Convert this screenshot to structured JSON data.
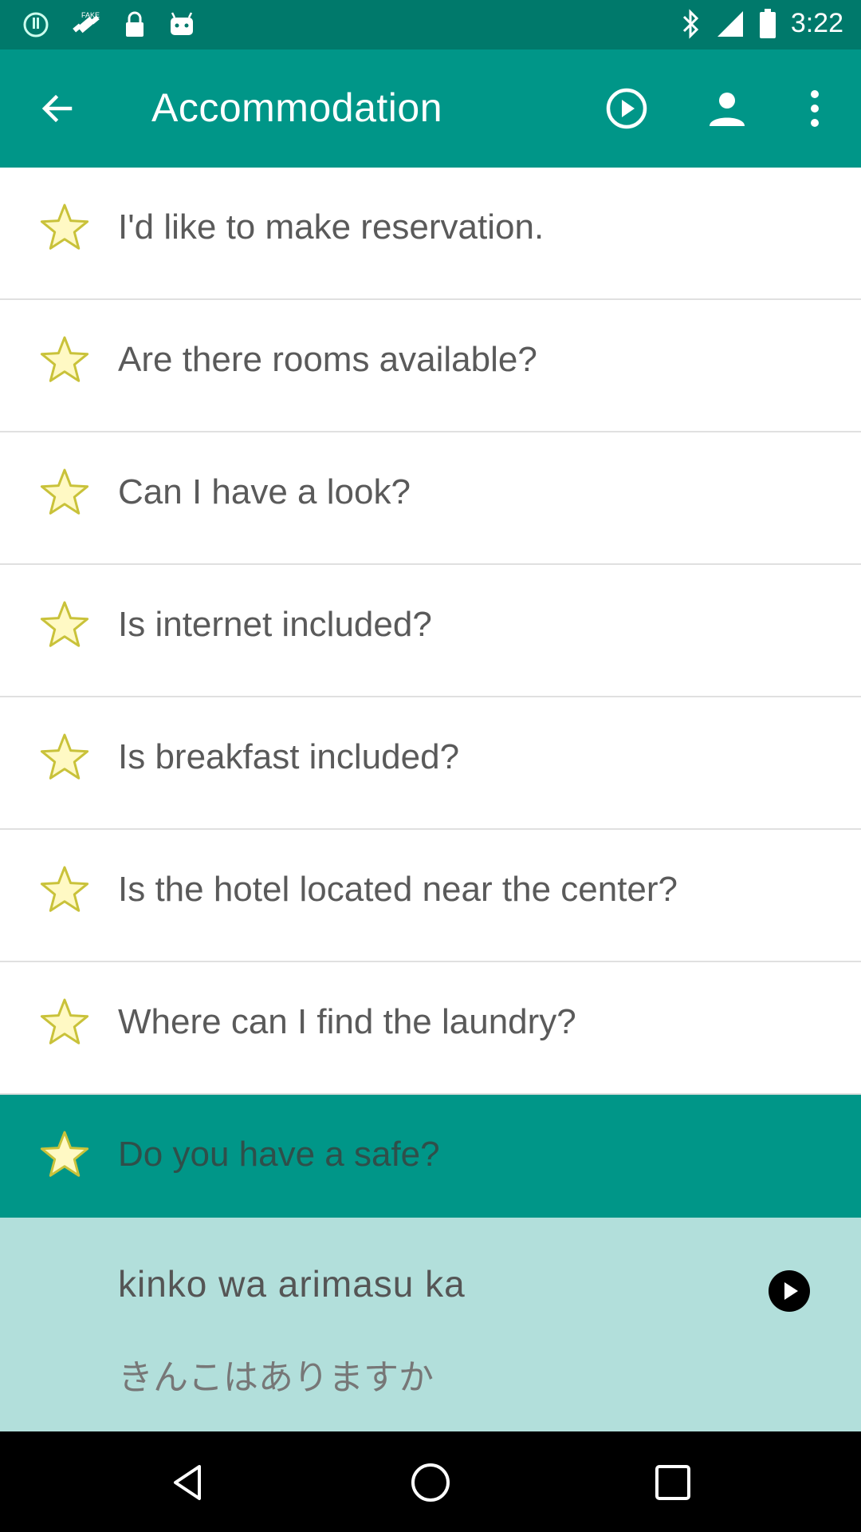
{
  "status_bar": {
    "time": "3:22",
    "icons": [
      "alert-circle-icon",
      "fake-gps-satellite-icon",
      "lock-icon",
      "android-icon",
      "bluetooth-icon",
      "signal-icon",
      "battery-icon"
    ]
  },
  "app_bar": {
    "title": "Accommodation",
    "back_icon": "arrow-left-icon",
    "actions": [
      "play-circle-icon",
      "person-icon",
      "more-vert-icon"
    ]
  },
  "phrases": [
    {
      "text": "I'd like to make reservation.",
      "starred": false
    },
    {
      "text": "Are there rooms available?",
      "starred": false
    },
    {
      "text": "Can I have a look?",
      "starred": false
    },
    {
      "text": "Is internet included?",
      "starred": false
    },
    {
      "text": "Is breakfast included?",
      "starred": false
    },
    {
      "text": "Is the hotel located near the center?",
      "starred": false
    },
    {
      "text": "Where can I find the laundry?",
      "starred": false
    },
    {
      "text": "Do you have a safe?",
      "starred": false,
      "selected": true
    }
  ],
  "detail": {
    "romaji": "kinko wa arimasu ka",
    "kana": "きんこはありますか",
    "play_icon": "play-filled-icon"
  },
  "nav_bar": {
    "icons": [
      "back-triangle-icon",
      "home-circle-icon",
      "recents-square-icon"
    ]
  },
  "colors": {
    "status_bar": "#00796b",
    "app_bar": "#009688",
    "selected_row": "#009688",
    "detail_panel": "#b2dfdb",
    "star_fill": "#fff9c4",
    "star_stroke": "#c9c23a"
  }
}
